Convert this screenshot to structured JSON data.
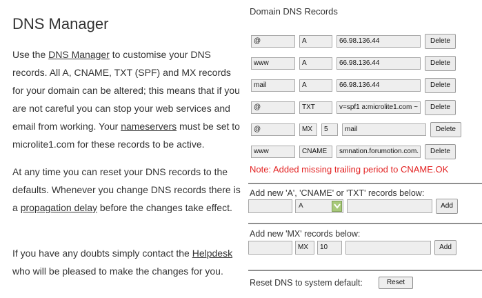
{
  "page": {
    "title": "DNS Manager",
    "p1": {
      "t1": "Use the ",
      "link1": "DNS Manager",
      "t2": " to customise your DNS records. All A, CNAME, TXT (SPF) and MX records for your domain can be altered; this means that if you are not careful you can stop your web services and email from working. Your ",
      "link2": "nameservers",
      "t3": " must be set to microlite1.com for these records to be active."
    },
    "p2": {
      "t1": "At any time you can reset your DNS records to the defaults. Whenever you change DNS records there is a ",
      "link": "propagation delay",
      "t2": " before the changes take effect."
    },
    "p3": {
      "t1": "If you have any doubts simply contact the ",
      "link": "Helpdesk",
      "t2": " who will be pleased to make the changes for you."
    }
  },
  "records": {
    "title": "Domain DNS Records",
    "rows": [
      {
        "host": "@",
        "type": "A",
        "value": "66.98.136.44",
        "delete": "Delete"
      },
      {
        "host": "www",
        "type": "A",
        "value": "66.98.136.44",
        "delete": "Delete"
      },
      {
        "host": "mail",
        "type": "A",
        "value": "66.98.136.44",
        "delete": "Delete"
      },
      {
        "host": "@",
        "type": "TXT",
        "value": "v=spf1 a:microlite1.com ~",
        "delete": "Delete"
      },
      {
        "host": "@",
        "type": "MX",
        "priority": "5",
        "value": "mail",
        "delete": "Delete"
      },
      {
        "host": "www",
        "type": "CNAME",
        "value": "smnation.forumotion.com.",
        "delete": "Delete"
      }
    ],
    "note": "Note: Added missing trailing period to CNAME.OK"
  },
  "add_record": {
    "label": "Add new 'A', 'CNAME' or 'TXT' records below:",
    "type_selected": "A",
    "add": "Add"
  },
  "add_mx": {
    "label": "Add new 'MX' records below:",
    "type": "MX",
    "priority": "10",
    "add": "Add"
  },
  "reset": {
    "label": "Reset DNS to system default:",
    "button": "Reset"
  },
  "colors": {
    "note": "#e32222",
    "select_arrow": "#a8c97a"
  }
}
